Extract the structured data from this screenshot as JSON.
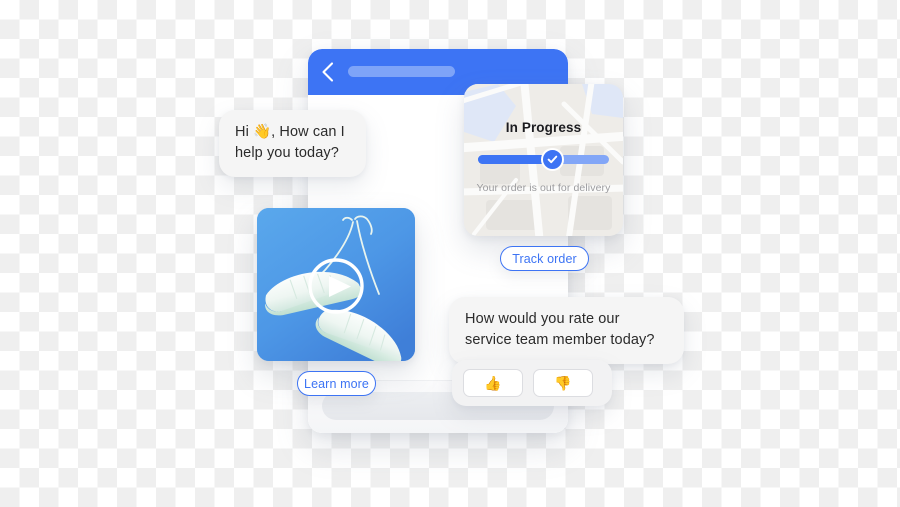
{
  "window": {
    "header": {
      "back_icon": "chevron-left-icon",
      "title_placeholder": ""
    },
    "composer": {
      "placeholder": ""
    }
  },
  "messages": {
    "greeting": "Hi 👋, How can I help you today?",
    "rating_prompt": "How would you rate our service team member today?"
  },
  "rating": {
    "thumbs_up": "👍",
    "thumbs_down": "👎",
    "up_icon": "thumbs-up-icon",
    "down_icon": "thumbs-down-icon"
  },
  "order_card": {
    "status_title": "In Progress",
    "status_subtitle": "Your order is out for delivery",
    "progress_percent": 57,
    "check_icon": "check-icon",
    "map_icon": "map-background"
  },
  "buttons": {
    "track_order": "Track order",
    "learn_more": "Learn more"
  },
  "video_card": {
    "play_icon": "play-button-icon",
    "alt": "white sneakers hanging on blue background"
  },
  "colors": {
    "brand_blue": "#3d74f4",
    "header_pill": "#7ea4f8",
    "progress_track": "#82a6f7",
    "bubble_gray": "#f5f5f5",
    "tray_gray": "#f2f2f3",
    "text_dark": "#2b2b2b",
    "text_muted": "#9b9b9e"
  }
}
